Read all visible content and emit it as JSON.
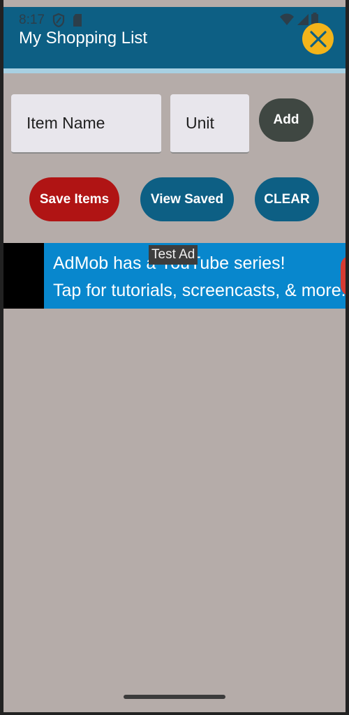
{
  "status": {
    "time": "8:17",
    "icons": [
      "shield-icon",
      "sd-card-icon",
      "wifi-icon",
      "signal-icon",
      "battery-icon"
    ]
  },
  "appbar": {
    "title": "My Shopping List",
    "close_icon": "close-icon"
  },
  "form": {
    "item_name_placeholder": "Item Name",
    "unit_placeholder": "Unit",
    "add_label": "Add"
  },
  "actions": {
    "save_label": "Save Items",
    "view_label": "View Saved",
    "clear_label": "CLEAR"
  },
  "ad": {
    "badge": "Test Ad",
    "line1": "AdMob has a YouTube series!",
    "line2": "Tap for tutorials, screencasts, & more."
  },
  "colors": {
    "background": "#b5aca9",
    "appbar": "#0d5f84",
    "close_button": "#f3b41a",
    "save_button": "#b01414",
    "view_button": "#0d5f84",
    "clear_button": "#0d5f84",
    "add_button": "#3f4742",
    "ad_banner": "#0887cd"
  }
}
